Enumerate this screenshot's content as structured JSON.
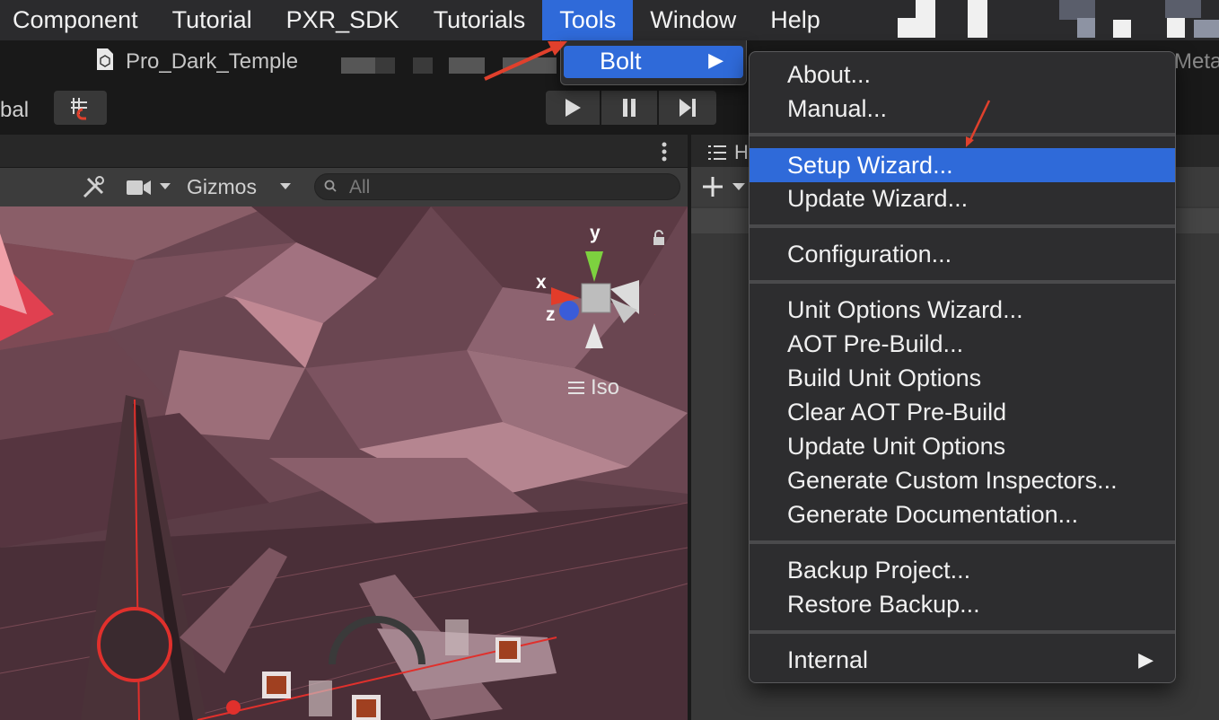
{
  "menubar": {
    "items": [
      {
        "label": "Component"
      },
      {
        "label": "Tutorial"
      },
      {
        "label": "PXR_SDK"
      },
      {
        "label": "Tutorials"
      },
      {
        "label": "Tools",
        "active": true
      },
      {
        "label": "Window"
      },
      {
        "label": "Help"
      }
    ]
  },
  "titlebar": {
    "document_title": "Pro_Dark_Temple",
    "right_label": "Meta"
  },
  "toolbar": {
    "global_label": "bal"
  },
  "scene": {
    "gizmos_label": "Gizmos",
    "search_placeholder": "All",
    "projection_label": "Iso",
    "axes": {
      "y": "y",
      "x": "x",
      "z": "z"
    }
  },
  "hierarchy": {
    "tab_label": "H"
  },
  "tools_menu": {
    "items": [
      {
        "label": "Bolt",
        "has_submenu": true
      }
    ]
  },
  "bolt_submenu": {
    "groups": [
      [
        {
          "label": "About..."
        },
        {
          "label": "Manual..."
        }
      ],
      [
        {
          "label": "Setup Wizard...",
          "highlighted": true
        },
        {
          "label": "Update Wizard..."
        }
      ],
      [
        {
          "label": "Configuration..."
        }
      ],
      [
        {
          "label": "Unit Options Wizard..."
        },
        {
          "label": "AOT Pre-Build..."
        },
        {
          "label": "Build Unit Options"
        },
        {
          "label": "Clear AOT Pre-Build"
        },
        {
          "label": "Update Unit Options"
        },
        {
          "label": "Generate Custom Inspectors..."
        },
        {
          "label": "Generate Documentation..."
        }
      ],
      [
        {
          "label": "Backup Project..."
        },
        {
          "label": "Restore Backup..."
        }
      ],
      [
        {
          "label": "Internal",
          "has_submenu": true
        }
      ]
    ]
  },
  "colors": {
    "menu_highlight": "#2f6ad9",
    "annotation_arrow": "#e0402c",
    "scene_background": "#5b3c46"
  }
}
